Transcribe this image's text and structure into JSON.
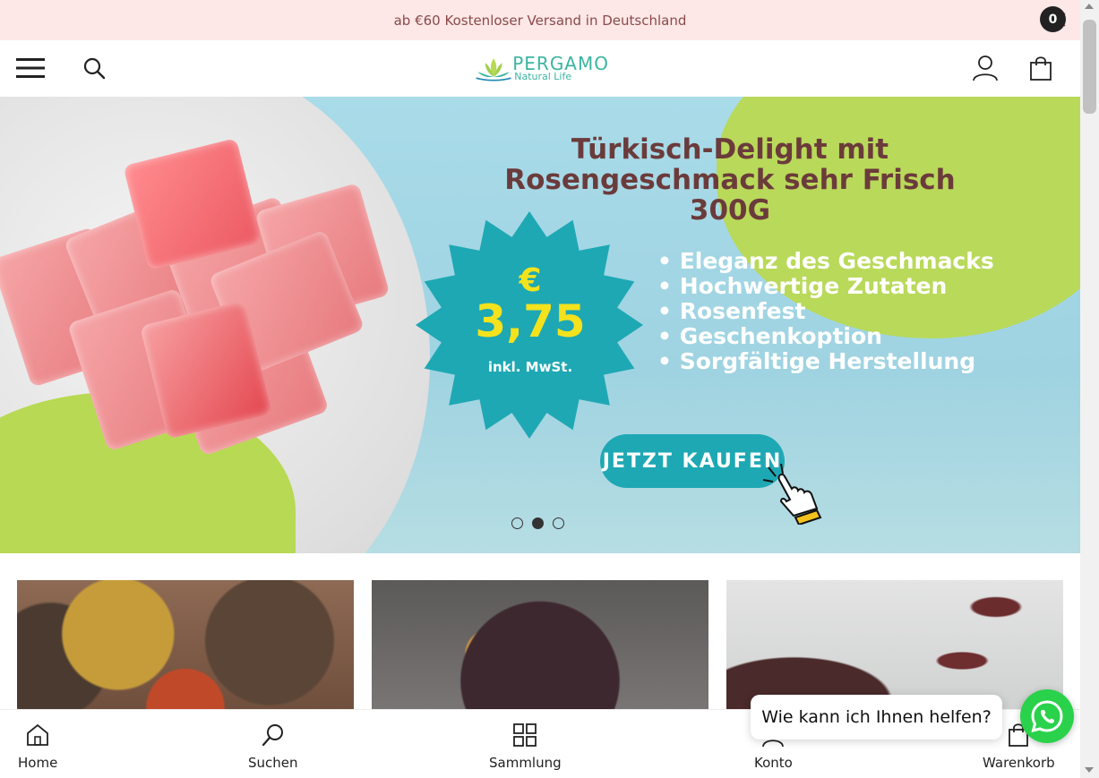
{
  "announcement": {
    "text": "ab €60 Kostenloser Versand in Deutschland"
  },
  "header": {
    "logo_brand": "PERGAMO",
    "logo_sub": "Natural Life",
    "cart_count": "0"
  },
  "hero": {
    "title": "Türkisch-Delight mit Rosengeschmack sehr Frisch 300G",
    "features": [
      "Eleganz des Geschmacks",
      "Hochwertige Zutaten",
      "Rosenfest",
      "Geschenkoption",
      "Sorgfältige Herstellung"
    ],
    "price_currency": "€",
    "price_value": "3,75",
    "price_tax": "inkl. MwSt.",
    "cta_label": "JETZT KAUFEN",
    "slides_total": 3,
    "active_slide": 2
  },
  "chat": {
    "bubble_text": "Wie kann ich Ihnen helfen?"
  },
  "bottom_nav": {
    "items": [
      {
        "label": "Home",
        "icon": "home-icon"
      },
      {
        "label": "Suchen",
        "icon": "search-icon"
      },
      {
        "label": "Sammlung",
        "icon": "grid-icon"
      },
      {
        "label": "Konto",
        "icon": "user-icon"
      },
      {
        "label": "Warenkorb",
        "icon": "cart-icon"
      }
    ]
  },
  "colors": {
    "announcement_bg": "#fde7e7",
    "accent_teal": "#1ea8b4",
    "accent_green": "#b8d954",
    "price_yellow": "#f4e21d",
    "whatsapp_green": "#2ad14b"
  }
}
